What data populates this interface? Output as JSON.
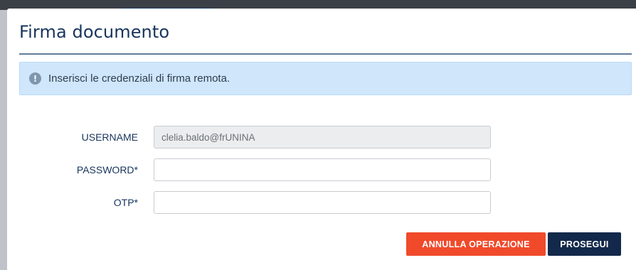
{
  "dialog": {
    "title": "Firma documento",
    "alert_icon": "exclamation-circle-icon",
    "alert_text": "Inserisci le credenziali di firma remota."
  },
  "form": {
    "username_label": "USERNAME",
    "username_value": "clelia.baldo@frUNINA",
    "password_label": "PASSWORD*",
    "password_value": "",
    "otp_label": "OTP*",
    "otp_value": ""
  },
  "actions": {
    "cancel_label": "ANNULLA OPERAZIONE",
    "proceed_label": "PROSEGUI"
  },
  "colors": {
    "title": "#17355c",
    "alert_bg": "#cfe6fb",
    "cancel_bg": "#f04a2b",
    "proceed_bg": "#13294b"
  }
}
